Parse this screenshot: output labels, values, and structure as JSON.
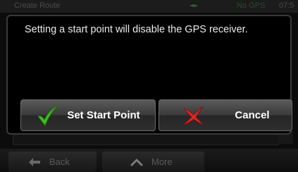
{
  "background": {
    "title": "Create Route",
    "status_text": "No GPS",
    "time": "07:5",
    "satellite_icon": "satellite-icon"
  },
  "dialog": {
    "message": "Setting a start point will disable the GPS receiver.",
    "confirm_button": {
      "label": "Set Start Point",
      "icon": "checkmark-icon",
      "icon_color": "#3fbf1f"
    },
    "cancel_button": {
      "label": "Cancel",
      "icon": "red-x-icon",
      "icon_color": "#d42a2a"
    }
  },
  "bottom_bar": {
    "back_label": "Back",
    "more_label": "More"
  }
}
